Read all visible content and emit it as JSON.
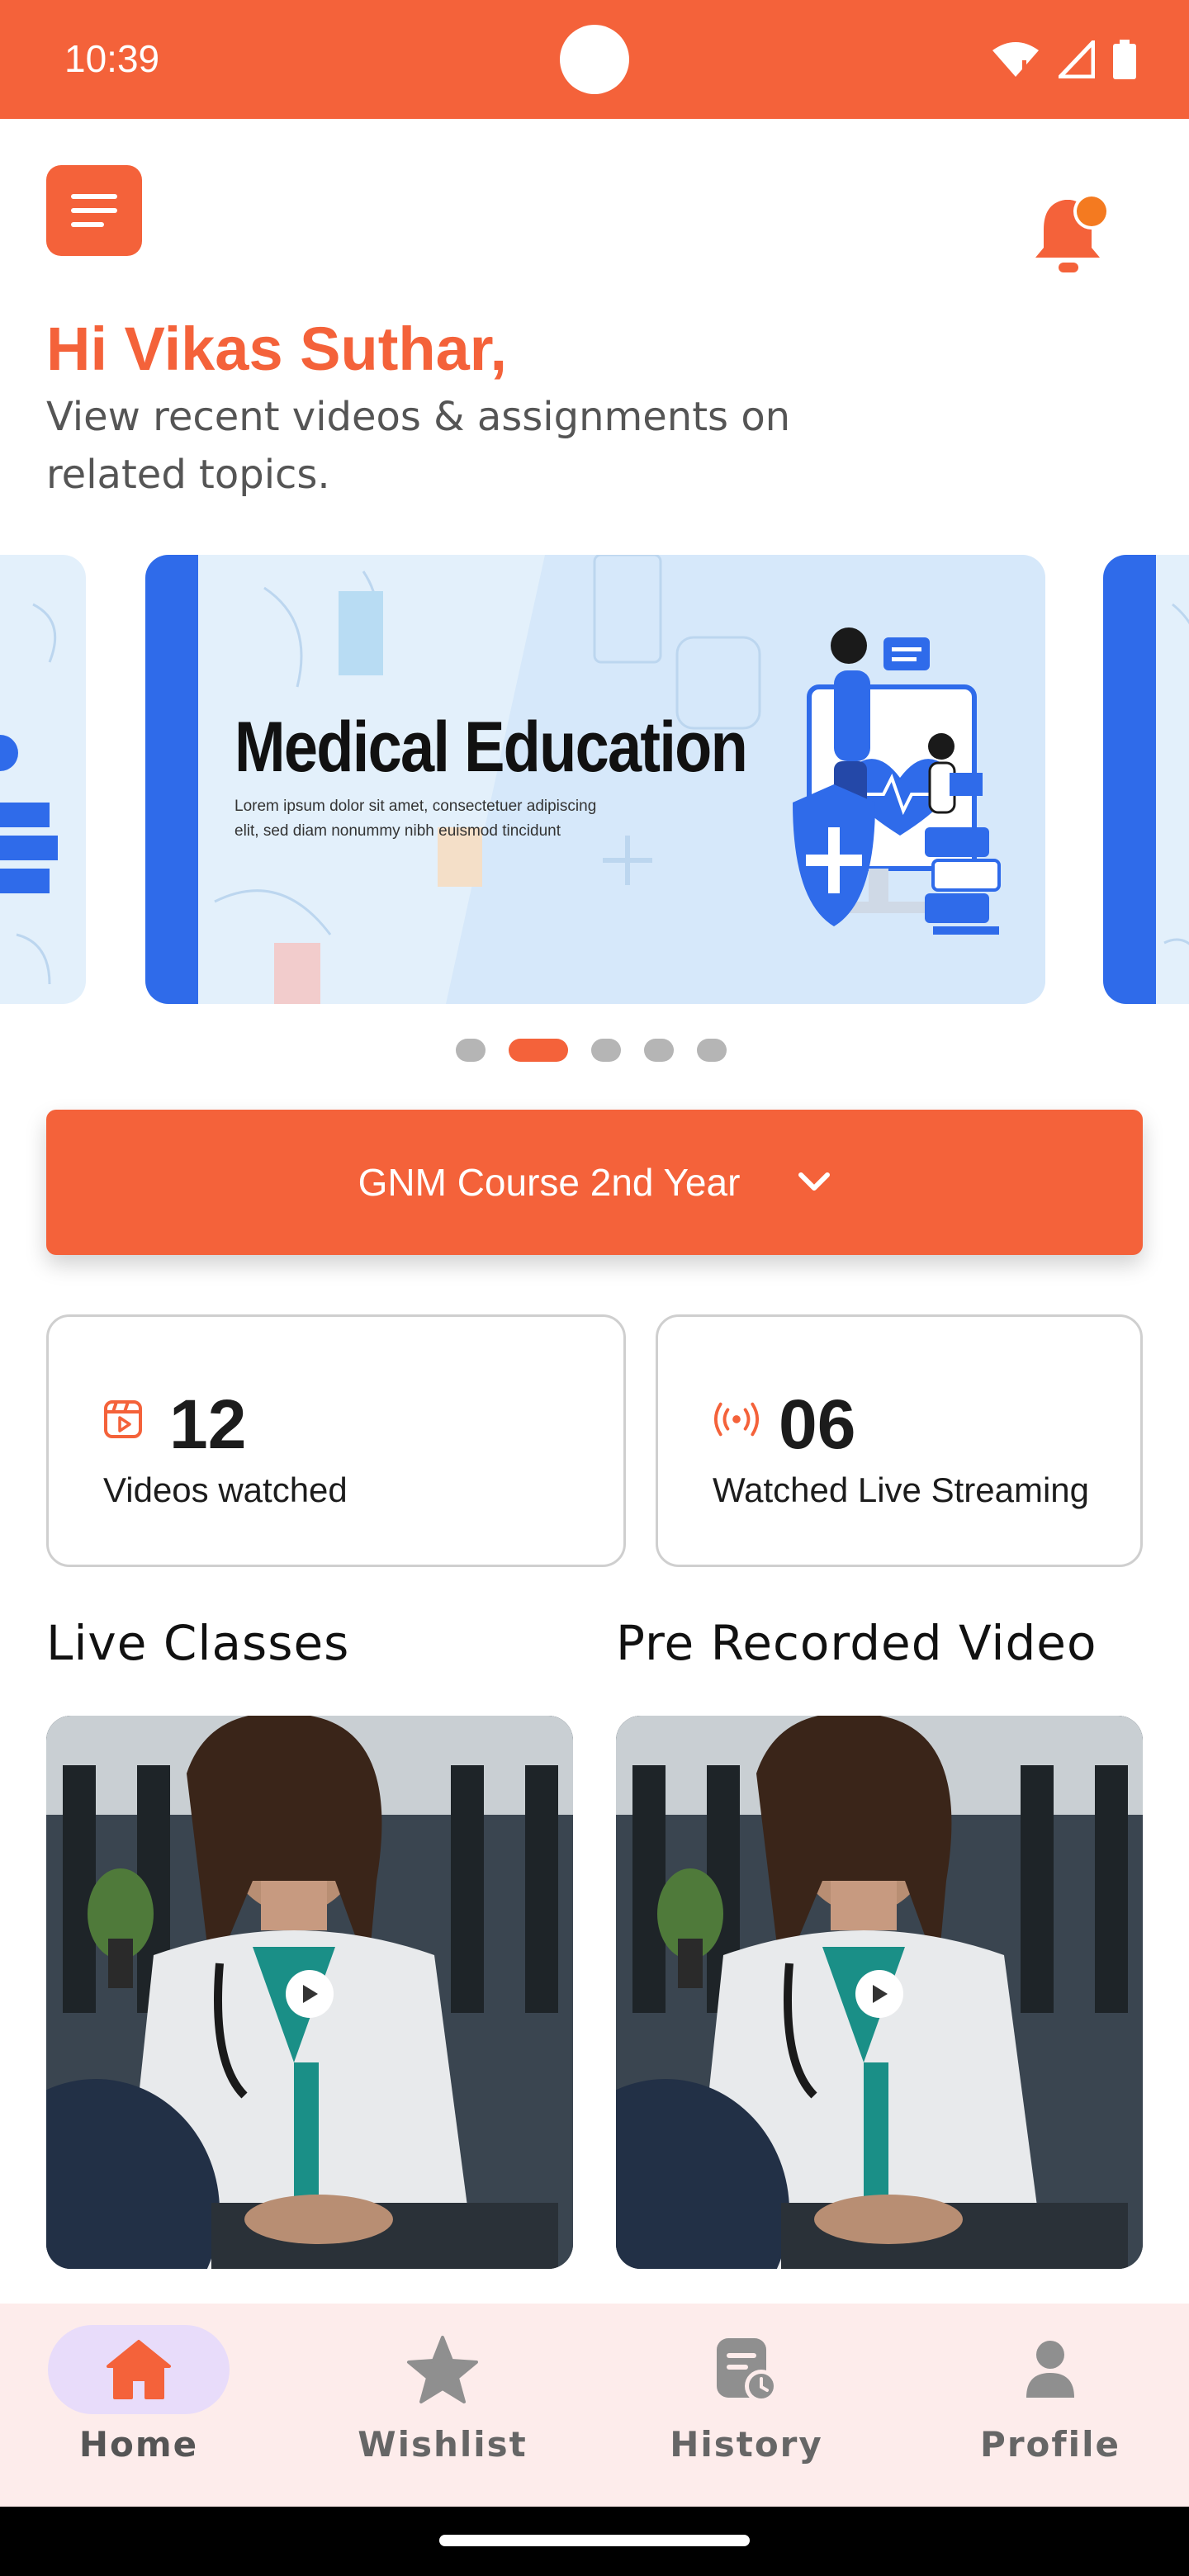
{
  "status_bar": {
    "time": "10:39",
    "icons": [
      "wifi-icon",
      "signal-icon",
      "battery-icon"
    ]
  },
  "header": {
    "menu_icon": "hamburger-menu-icon",
    "notification_icon": "bell-icon",
    "greeting": "Hi Vikas Suthar,",
    "subtitle": "View recent videos & assignments on related topics."
  },
  "carousel": {
    "slides": [
      {
        "title": "Medical Education",
        "body": "Lorem ipsum dolor sit amet, consectetuer adipiscing elit, sed diam nonummy nibh euismod tincidunt"
      }
    ],
    "dot_count": 5,
    "active_index": 1
  },
  "course_selector": {
    "selected": "GNM Course 2nd Year",
    "icon": "chevron-down-icon"
  },
  "stats": [
    {
      "value": "12",
      "label": "Videos watched",
      "icon": "video-play-icon"
    },
    {
      "value": "06",
      "label": "Watched Live Streaming",
      "icon": "live-broadcast-icon"
    }
  ],
  "sections": {
    "live_title": "Live Classes",
    "prerecorded_title": "Pre Recorded Video"
  },
  "bottom_nav": {
    "items": [
      {
        "label": "Home",
        "icon": "home-icon",
        "active": true
      },
      {
        "label": "Wishlist",
        "icon": "star-icon",
        "active": false
      },
      {
        "label": "History",
        "icon": "history-icon",
        "active": false
      },
      {
        "label": "Profile",
        "icon": "profile-icon",
        "active": false
      }
    ]
  },
  "colors": {
    "accent": "#F4623A",
    "slide_blue": "#2F6BEA",
    "nav_background": "#FDECEB",
    "active_pill": "#E8DCFA"
  }
}
